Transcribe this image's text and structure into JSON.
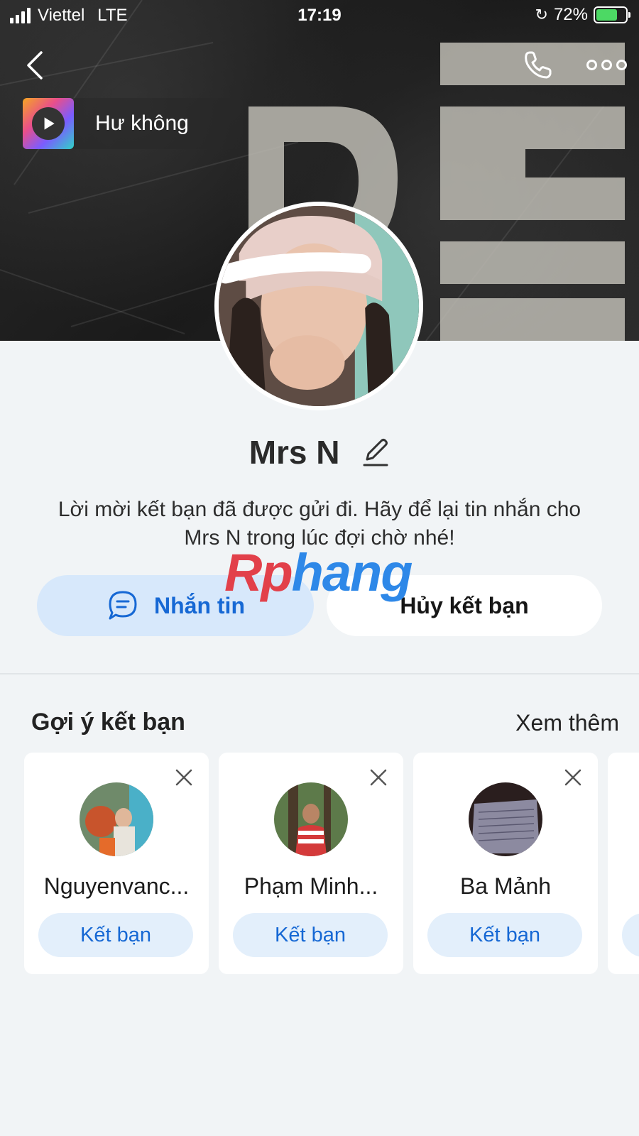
{
  "status_bar": {
    "carrier": "Viettel",
    "network": "LTE",
    "time": "17:19",
    "battery_percent_label": "72%",
    "battery_level": 0.72
  },
  "music": {
    "title": "Hư không"
  },
  "profile": {
    "name": "Mrs N",
    "info": "Lời mời kết bạn đã được gửi đi. Hãy để lại tin nhắn cho Mrs N trong lúc đợi chờ nhé!"
  },
  "actions": {
    "message_label": "Nhắn tin",
    "unfriend_label": "Hủy kết bạn"
  },
  "watermark": {
    "part1": "Rp",
    "part2": "hang"
  },
  "suggestions": {
    "title": "Gợi ý kết bạn",
    "see_more": "Xem thêm",
    "items": [
      {
        "name": "Nguyenvanc...",
        "button": "Kết bạn"
      },
      {
        "name": "Phạm Minh...",
        "button": "Kết bạn"
      },
      {
        "name": "Ba Mảnh",
        "button": "Kết bạn"
      }
    ]
  },
  "colors": {
    "accent": "#1668d4",
    "accent_light": "#d7e8fb",
    "background": "#f1f4f6",
    "battery_green": "#4cd964"
  },
  "icons": [
    "back-icon",
    "phone-icon",
    "more-icon",
    "play-icon",
    "edit-icon",
    "message-icon",
    "close-icon"
  ]
}
